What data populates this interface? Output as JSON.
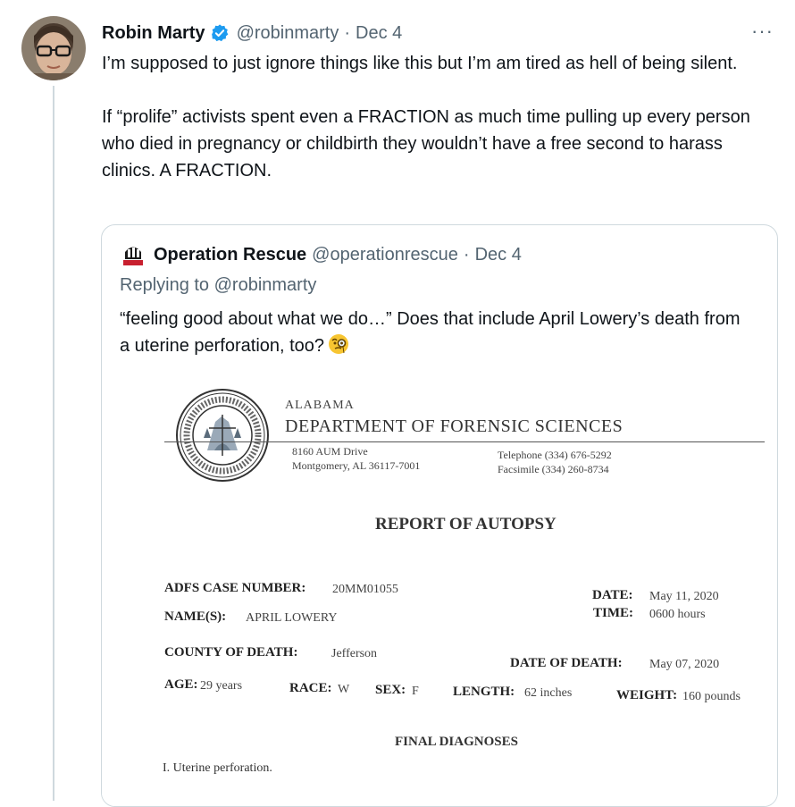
{
  "tweet": {
    "author_name": "Robin Marty",
    "handle": "@robinmarty",
    "dot": "·",
    "date": "Dec 4",
    "more": "···",
    "paragraph1": "I’m supposed to just ignore things like this but I’m am tired as hell of being silent.",
    "paragraph2": "If “prolife” activists spent even a FRACTION as much time pulling up every person who died in pregnancy or childbirth they wouldn’t have a free second to harass clinics. A FRACTION."
  },
  "quote": {
    "author_name": "Operation Rescue",
    "handle": "@operationrescue",
    "dot": "·",
    "date": "Dec 4",
    "replying_prefix": "Replying to",
    "replying_handle": "@robinmarty",
    "text": "“feeling good about what we do…” Does that include April Lowery’s death from a uterine perforation, too?",
    "emoji_name": "face-with-monocle"
  },
  "document": {
    "dept_line1": "ALABAMA",
    "dept_line2": "DEPARTMENT OF FORENSIC SCIENCES",
    "addr_line1": "8160 AUM Drive",
    "addr_line2": "Montgomery, AL 36117-7001",
    "tel_line1": "Telephone (334) 676-5292",
    "tel_line2": "Facsimile (334) 260-8734",
    "title": "REPORT OF AUTOPSY",
    "case_label": "ADFS CASE NUMBER:",
    "case_value": "20MM01055",
    "date_label": "DATE:",
    "date_value": "May 11, 2020",
    "time_label": "TIME:",
    "time_value": "0600 hours",
    "name_label": "NAME(S):",
    "name_value": "APRIL LOWERY",
    "county_label": "COUNTY OF DEATH:",
    "county_value": "Jefferson",
    "dod_label": "DATE OF DEATH:",
    "dod_value": "May 07, 2020",
    "age_label": "AGE:",
    "age_value": "29 years",
    "race_label": "RACE:",
    "race_value": "W",
    "sex_label": "SEX:",
    "sex_value": "F",
    "length_label": "LENGTH:",
    "length_value": "62 inches",
    "weight_label": "WEIGHT:",
    "weight_value": "160 pounds",
    "final_diagnoses": "FINAL DIAGNOSES",
    "diagnosis_1": "I.   Uterine perforation."
  },
  "colors": {
    "text": "#0f1419",
    "secondary": "#536471",
    "border": "#cfd9de",
    "verified": "#1d9bf0"
  }
}
